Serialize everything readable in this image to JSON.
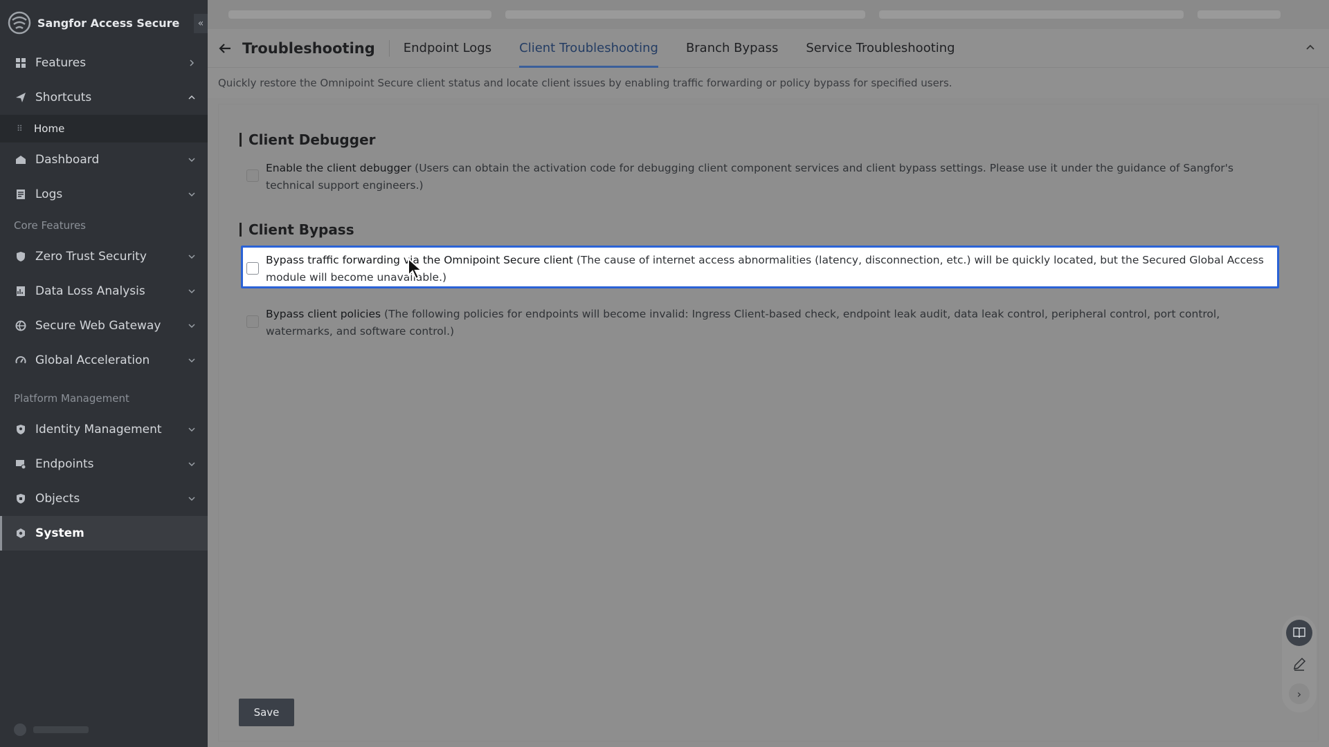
{
  "sidebar": {
    "brand": "Sangfor Access Secure",
    "collapse_icon": "«",
    "items_top": [
      {
        "label": "Features",
        "icon": "grid-icon"
      },
      {
        "label": "Shortcuts",
        "icon": "send-icon"
      }
    ],
    "shortcut_sub": "Home",
    "items_mid": [
      {
        "label": "Dashboard",
        "icon": "dashboard-icon"
      },
      {
        "label": "Logs",
        "icon": "logs-icon"
      }
    ],
    "section_core": "Core Features",
    "core_items": [
      {
        "label": "Zero Trust Security",
        "icon": "shield-icon"
      },
      {
        "label": "Data Loss Analysis",
        "icon": "chart-icon"
      },
      {
        "label": "Secure Web Gateway",
        "icon": "globe-icon"
      },
      {
        "label": "Global Acceleration",
        "icon": "speed-icon"
      }
    ],
    "section_platform": "Platform Management",
    "platform_items": [
      {
        "label": "Identity Management",
        "icon": "identity-icon"
      },
      {
        "label": "Endpoints",
        "icon": "endpoint-icon"
      },
      {
        "label": "Objects",
        "icon": "objects-icon"
      },
      {
        "label": "System",
        "icon": "system-icon"
      }
    ]
  },
  "header": {
    "title": "Troubleshooting",
    "tabs": [
      "Endpoint Logs",
      "Client Troubleshooting",
      "Branch Bypass",
      "Service Troubleshooting"
    ],
    "active_tab": "Client Troubleshooting"
  },
  "description": "Quickly restore the Omnipoint Secure client status and locate client issues by enabling traffic forwarding or policy bypass for specified users.",
  "client_debugger": {
    "title": "Client Debugger",
    "option": {
      "label": "Enable the client debugger",
      "note": "(Users can obtain the activation code for debugging client component services and client bypass settings. Please use it under the guidance of Sangfor's technical support engineers.)",
      "checked": false
    }
  },
  "client_bypass": {
    "title": "Client Bypass",
    "options": [
      {
        "label": "Bypass traffic forwarding via the Omnipoint Secure client",
        "note": "(The cause of internet access abnormalities (latency, disconnection, etc.) will be quickly located, but the Secured Global Access module will become unavailable.)",
        "checked": false
      },
      {
        "label": "Bypass client policies",
        "note": "(The following policies for endpoints will become invalid: Ingress Client-based check, endpoint leak audit, data leak control, peripheral control, port control, watermarks, and software control.)",
        "checked": false
      }
    ]
  },
  "save_label": "Save",
  "colors": {
    "sidebar_bg": "#2f3237",
    "highlight_border": "#2a62d6",
    "active_tab_underline": "#3a5f9a"
  }
}
